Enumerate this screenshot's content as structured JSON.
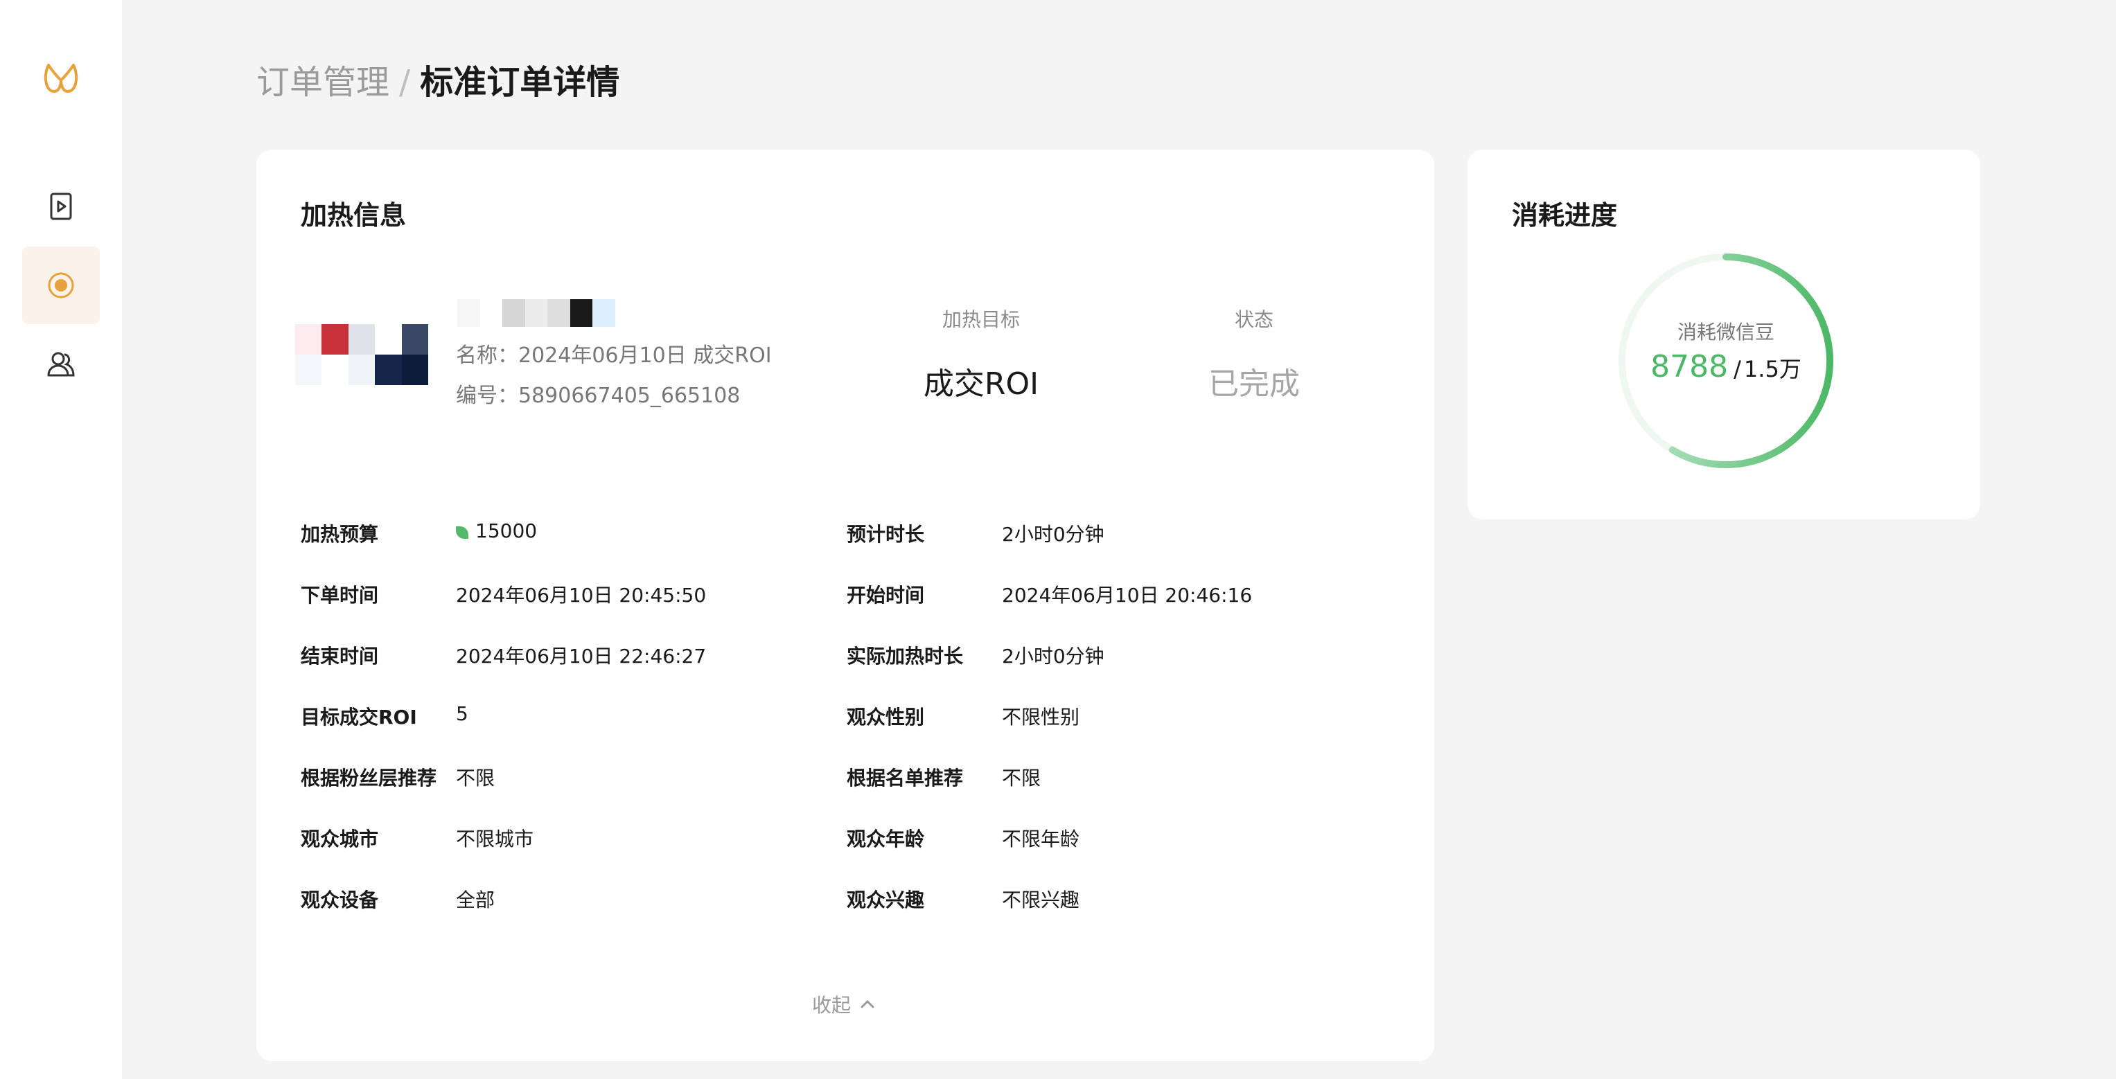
{
  "breadcrumb": {
    "parent": "订单管理",
    "separator": "/",
    "current": "标准订单详情"
  },
  "sidebar": {
    "items": [
      {
        "icon": "play-file-icon",
        "active": false
      },
      {
        "icon": "target-circle-icon",
        "active": true
      },
      {
        "icon": "users-icon",
        "active": false
      }
    ]
  },
  "heat_info": {
    "title": "加热信息",
    "name_label": "名称：",
    "name_value": "2024年06月10日 成交ROI",
    "code_label": "编号：",
    "code_value": "5890667405_665108",
    "target_label": "加热目标",
    "target_value": "成交ROI",
    "status_label": "状态",
    "status_value": "已完成"
  },
  "details": {
    "left": [
      {
        "key": "加热预算",
        "value": "15000"
      },
      {
        "key": "下单时间",
        "value": "2024年06月10日 20:45:50"
      },
      {
        "key": "结束时间",
        "value": "2024年06月10日 22:46:27"
      },
      {
        "key": "目标成交ROI",
        "value": "5"
      },
      {
        "key": "根据粉丝层推荐",
        "value": "不限"
      },
      {
        "key": "观众城市",
        "value": "不限城市"
      },
      {
        "key": "观众设备",
        "value": "全部"
      }
    ],
    "right": [
      {
        "key": "预计时长",
        "value": "2小时0分钟"
      },
      {
        "key": "开始时间",
        "value": "2024年06月10日 20:46:16"
      },
      {
        "key": "实际加热时长",
        "value": "2小时0分钟"
      },
      {
        "key": "观众性别",
        "value": "不限性别"
      },
      {
        "key": "根据名单推荐",
        "value": "不限"
      },
      {
        "key": "观众年龄",
        "value": "不限年龄"
      },
      {
        "key": "观众兴趣",
        "value": "不限兴趣"
      }
    ]
  },
  "collapse_label": "收起",
  "progress": {
    "title": "消耗进度",
    "ring_label": "消耗微信豆",
    "used": "8788",
    "separator": "/",
    "total": "1.5万",
    "fraction": 0.586,
    "color": "#4cb866"
  },
  "colors": {
    "accent": "#e8a23c",
    "accent_bg": "#fbf3e9",
    "success": "#4cb866",
    "muted": "#9a9a9a"
  }
}
